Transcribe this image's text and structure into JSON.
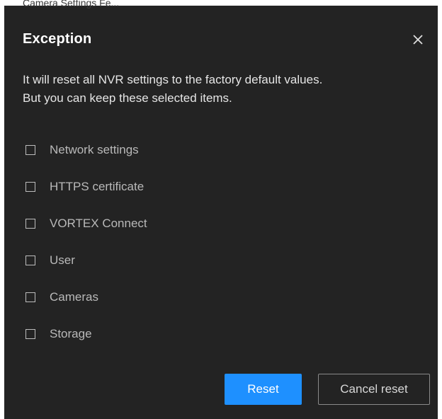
{
  "dialog": {
    "background_hint": "Camera Settings Fe...",
    "title": "Exception",
    "close_icon": "close-icon",
    "description": [
      "It will reset all NVR settings to the factory default values.",
      "But you can keep these selected items."
    ],
    "options": [
      {
        "label": "Network settings",
        "checked": false
      },
      {
        "label": "HTTPS certificate",
        "checked": false
      },
      {
        "label": "VORTEX Connect",
        "checked": false
      },
      {
        "label": "User",
        "checked": false
      },
      {
        "label": "Cameras",
        "checked": false
      },
      {
        "label": "Storage",
        "checked": false
      }
    ],
    "buttons": {
      "reset_label": "Reset",
      "cancel_label": "Cancel reset"
    }
  },
  "colors": {
    "dialog_bg": "#232323",
    "primary": "#1e90ff",
    "text": "#ffffff",
    "muted_text": "#b9b9b9"
  }
}
